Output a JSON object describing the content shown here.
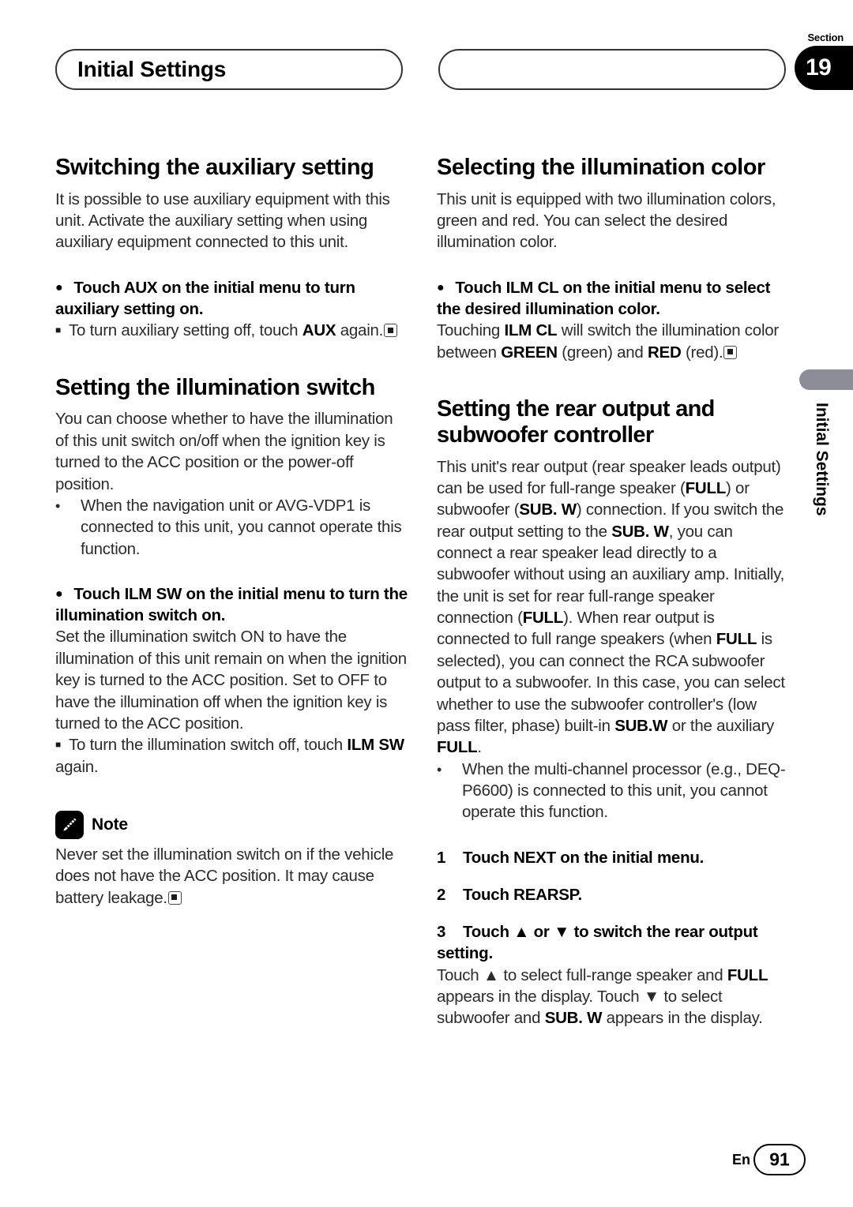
{
  "header": {
    "title": "Initial Settings",
    "section_label": "Section",
    "section_number": "19",
    "right_pill_text": ""
  },
  "side_tab": {
    "label": "Initial Settings"
  },
  "footer": {
    "language": "En",
    "page_number": "91"
  },
  "left_column": {
    "section1": {
      "heading": "Switching the auxiliary setting",
      "intro": "It is possible to use auxiliary equipment with this unit. Activate the auxiliary setting when using auxiliary equipment connected to this unit.",
      "instruction": "Touch AUX on the initial menu to turn auxiliary setting on.",
      "subnote_prefix": "To turn auxiliary setting off, touch ",
      "subnote_bold": "AUX",
      "subnote_suffix": " again."
    },
    "section2": {
      "heading": "Setting the illumination switch",
      "intro": "You can choose whether to have the illumination of this unit switch on/off when the ignition key is turned to the ACC position or the power-off position.",
      "dash_item": "When the navigation unit or AVG-VDP1 is connected to this unit, you cannot operate this function.",
      "instruction": "Touch ILM SW on the initial menu to turn the illumination switch on.",
      "body": "Set the illumination switch ON to have the illumination of this unit remain on when the ignition key is turned to the ACC position. Set to OFF to have the illumination off when the ignition key is turned to the ACC position.",
      "subnote_prefix": "To turn the illumination switch off, touch ",
      "subnote_bold": "ILM SW",
      "subnote_suffix": " again."
    },
    "note": {
      "icon": "pencil-icon",
      "label": "Note",
      "text": "Never set the illumination switch on if the vehicle does not have the ACC position. It may cause battery leakage."
    }
  },
  "right_column": {
    "section1": {
      "heading": "Selecting the illumination color",
      "intro": "This unit is equipped with two illumination colors, green and red. You can select the desired illumination color.",
      "instruction": "Touch ILM CL on the initial menu to select the desired illumination color.",
      "body_p1": "Touching ",
      "body_b1": "ILM CL",
      "body_p2": " will switch the illumination color between ",
      "body_b2": "GREEN",
      "body_p3": " (green) and ",
      "body_b3": "RED",
      "body_p4": " (red)."
    },
    "section2": {
      "heading": "Setting the rear output and subwoofer controller",
      "para_1": "This unit's rear output (rear speaker leads output) can be used for full-range speaker (",
      "para_b1": "FULL",
      "para_2": ") or subwoofer (",
      "para_b2": "SUB. W",
      "para_3": ") connection. If you switch the rear output setting to the ",
      "para_b3": "SUB. W",
      "para_4": ", you can connect a rear speaker lead directly to a subwoofer without using an auxiliary amp. Initially, the unit is set for rear full-range speaker connection (",
      "para_b4": "FULL",
      "para_5": "). When rear output is connected to full range speakers (when ",
      "para_b5": "FULL",
      "para_6": " is selected), you can connect the RCA subwoofer output to a subwoofer. In this case, you can select whether to use the subwoofer controller's (low pass filter, phase) built-in ",
      "para_b6": "SUB.W",
      "para_7": " or the auxiliary ",
      "para_b7": "FULL",
      "para_8": ".",
      "dash_item": "When the multi-channel processor (e.g., DEQ-P6600) is connected to this unit, you cannot operate this function.",
      "steps": [
        {
          "num": "1",
          "text": "Touch NEXT on the initial menu."
        },
        {
          "num": "2",
          "text": "Touch REARSP."
        },
        {
          "num": "3",
          "text": "Touch ▲ or ▼ to switch the rear output setting."
        }
      ],
      "step3_body_1": "Touch ▲ to select full-range speaker and ",
      "step3_body_b1": "FULL",
      "step3_body_2": " appears in the display. Touch ▼ to select subwoofer and ",
      "step3_body_b2": "SUB. W",
      "step3_body_3": " appears in the display."
    }
  }
}
